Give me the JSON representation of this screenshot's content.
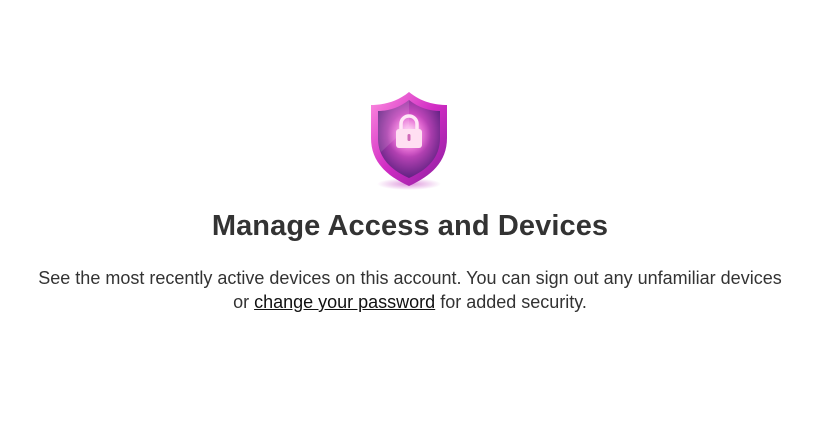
{
  "header": {
    "icon": "shield-lock-icon",
    "title": "Manage Access and Devices"
  },
  "description": {
    "text_before": "See the most recently active devices on this account. You can sign out any unfamiliar devices or ",
    "link_label": "change your password",
    "text_after": " for added security."
  },
  "colors": {
    "shield_outer": "#c026b8",
    "shield_inner": "#8e2ca8",
    "shield_glow": "#ff9be8",
    "text": "#333333"
  }
}
